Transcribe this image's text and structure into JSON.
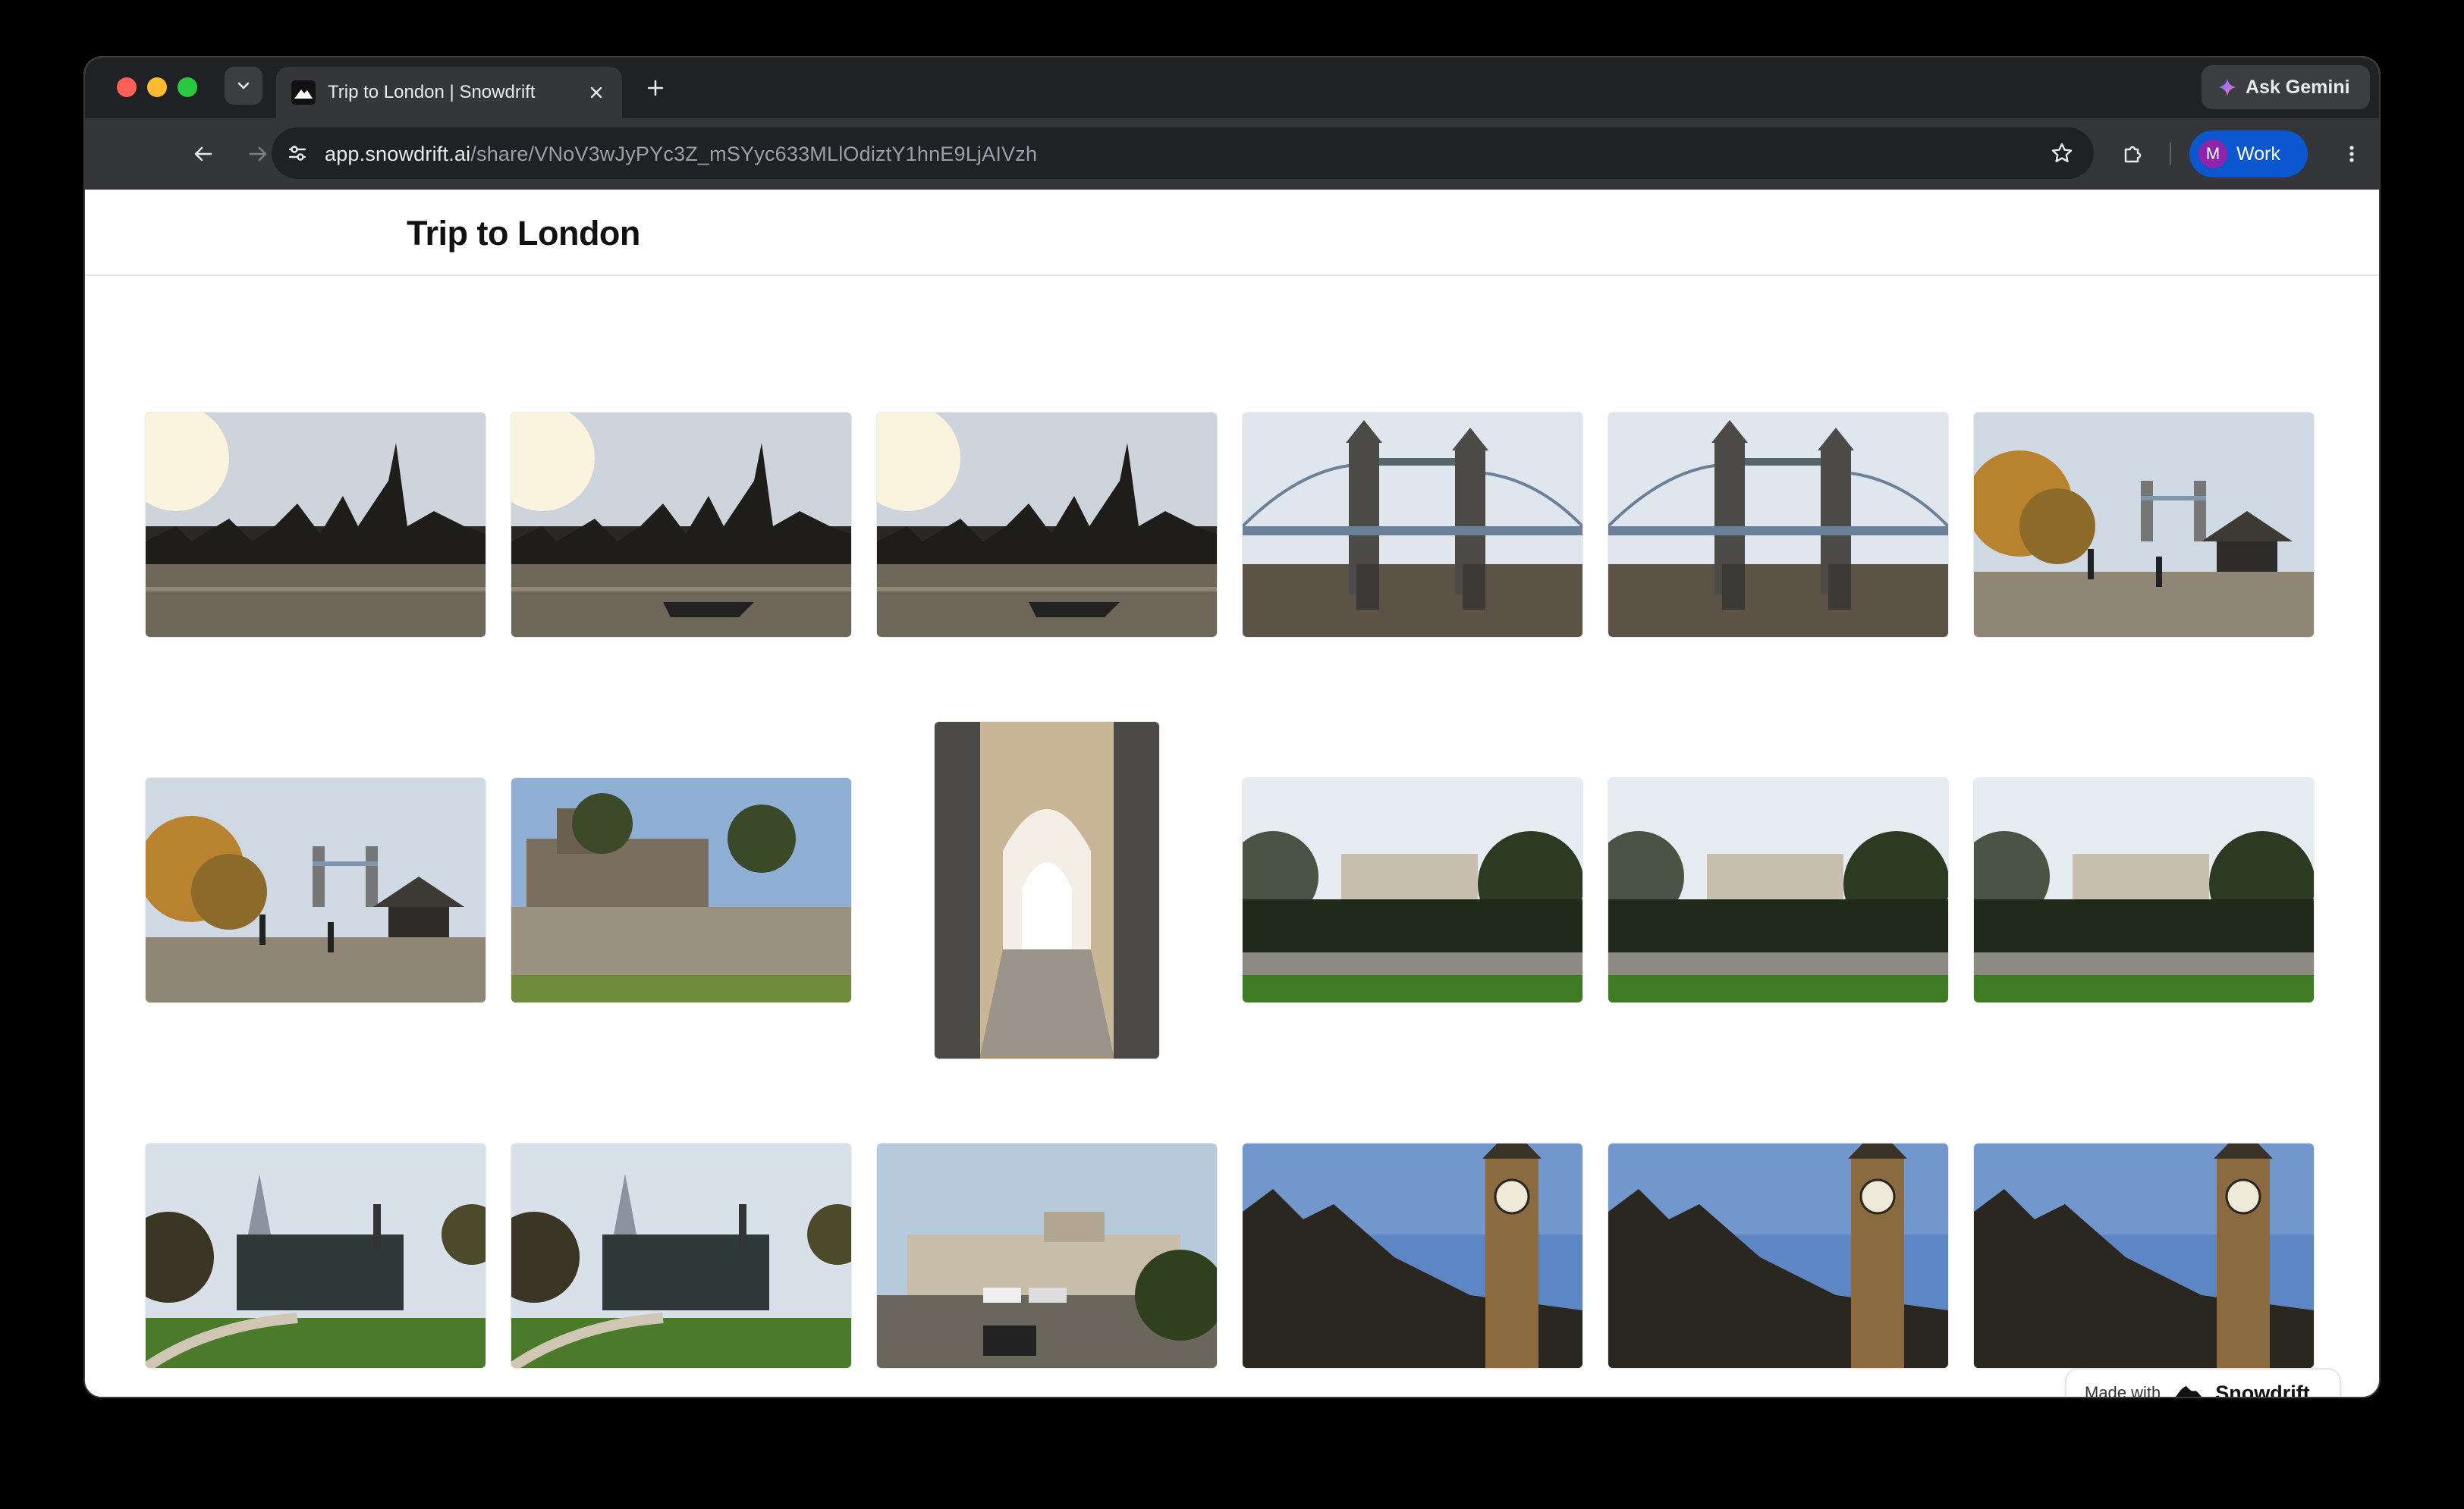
{
  "browser": {
    "tab_title": "Trip to London | Snowdrift",
    "url_host": "app.snowdrift.ai",
    "url_path": "/share/VNoV3wJyPYc3Z_mSYyc633MLlOdiztY1hnE9LjAIVzh",
    "gemini_label": "Ask Gemini",
    "profile_initial": "M",
    "profile_name": "Work"
  },
  "page": {
    "title": "Trip to London"
  },
  "gallery": {
    "photos": [
      {
        "subject": "city-skyline-shard"
      },
      {
        "subject": "city-skyline-shard-boat"
      },
      {
        "subject": "city-skyline-shard-boat"
      },
      {
        "subject": "tower-bridge"
      },
      {
        "subject": "tower-bridge"
      },
      {
        "subject": "riverside-walk-tower-bridge"
      },
      {
        "subject": "riverside-walk-tower-bridge"
      },
      {
        "subject": "tower-of-london-wall"
      },
      {
        "subject": "stone-archway-corridor"
      },
      {
        "subject": "tower-of-london-garden"
      },
      {
        "subject": "tower-of-london-garden"
      },
      {
        "subject": "tower-of-london-garden"
      },
      {
        "subject": "park-with-shard"
      },
      {
        "subject": "park-with-shard"
      },
      {
        "subject": "street-with-building"
      },
      {
        "subject": "big-ben"
      },
      {
        "subject": "big-ben"
      },
      {
        "subject": "big-ben"
      }
    ]
  },
  "badge": {
    "made_with": "Made with",
    "brand": "Snowdrift"
  }
}
